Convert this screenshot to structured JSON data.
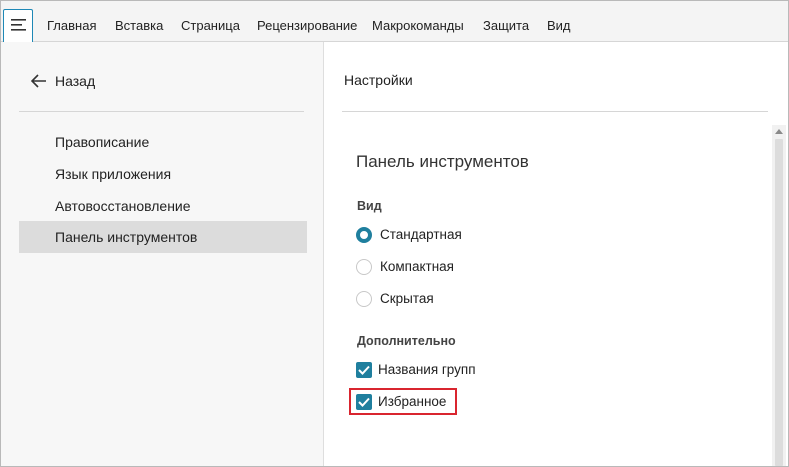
{
  "menubar": {
    "menu_icon": "hamburger-menu-icon",
    "tabs": [
      {
        "label": "Главная"
      },
      {
        "label": "Вставка"
      },
      {
        "label": "Страница"
      },
      {
        "label": "Рецензирование"
      },
      {
        "label": "Макрокоманды"
      },
      {
        "label": "Защита"
      },
      {
        "label": "Вид"
      }
    ]
  },
  "sidebar": {
    "back_icon": "arrow-left-icon",
    "back_label": "Назад",
    "items": [
      {
        "label": "Правописание",
        "active": false
      },
      {
        "label": "Язык приложения",
        "active": false
      },
      {
        "label": "Автовосстановление",
        "active": false
      },
      {
        "label": "Панель инструментов",
        "active": true
      }
    ]
  },
  "main": {
    "breadcrumb": "Настройки",
    "section_title": "Панель инструментов",
    "view_group": {
      "label": "Вид",
      "options": [
        {
          "label": "Стандартная",
          "checked": true
        },
        {
          "label": "Компактная",
          "checked": false
        },
        {
          "label": "Скрытая",
          "checked": false
        }
      ]
    },
    "extra_group": {
      "label": "Дополнительно",
      "options": [
        {
          "label": "Названия групп",
          "checked": true
        },
        {
          "label": "Избранное",
          "checked": true,
          "highlighted": true
        }
      ]
    }
  },
  "colors": {
    "accent": "#1f7f9e",
    "highlight_border": "#d9252f",
    "active_nav_bg": "#dcdcdc"
  }
}
